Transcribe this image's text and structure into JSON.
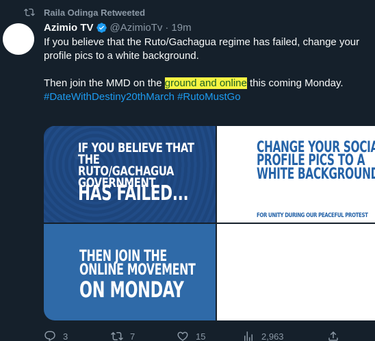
{
  "retweet_context": {
    "label": "Raila Odinga Retweeted"
  },
  "tweet": {
    "display_name": "Azimio TV",
    "handle": "@AzimioTv",
    "separator": "·",
    "time": "19m",
    "text_line1": "If you believe that the Ruto/Gachagua regime has failed, change your profile pics to a white background.",
    "text_line2_before": "Then join the MMD on the ",
    "text_line2_highlight": "ground and online",
    "text_line2_after": " this coming Monday.",
    "hashtags": [
      "#DateWithDestiny20thMarch",
      "#RutoMustGo"
    ]
  },
  "media": {
    "tile1": {
      "line1": "If you believe that the Ruto/Gachagua government",
      "line2": "has failed..."
    },
    "tile2": {
      "line1": "Change your social profile pics to a white background",
      "line2": "For unity during our peaceful protest"
    },
    "tile3": {
      "line1": "Then join the online movement",
      "line2": "on Monday"
    }
  },
  "actions": {
    "replies": "3",
    "retweets": "7",
    "likes": "15",
    "views": "2,963"
  },
  "icons": {
    "retweet_context": "retweet-icon",
    "verified": "verified-badge-icon",
    "reply": "reply-icon",
    "retweet": "retweet-icon",
    "like": "heart-icon",
    "views": "views-icon",
    "share": "share-icon"
  },
  "colors": {
    "background": "#15202b",
    "accent": "#1d9bf0",
    "secondary_text": "#8b98a5",
    "highlight": "#f6f442"
  }
}
